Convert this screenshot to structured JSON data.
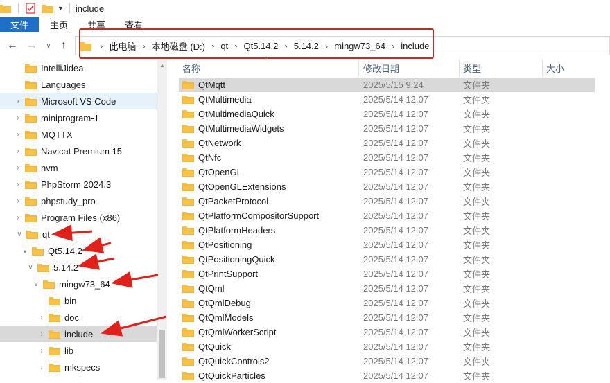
{
  "window": {
    "title": "include"
  },
  "ribbon": {
    "tabs": [
      "文件",
      "主页",
      "共享",
      "查看"
    ]
  },
  "address": {
    "crumbs": [
      "此电脑",
      "本地磁盘 (D:)",
      "qt",
      "Qt5.14.2",
      "5.14.2",
      "mingw73_64",
      "include"
    ]
  },
  "tree": {
    "items": [
      {
        "label": "IntelliJidea",
        "chevron": ""
      },
      {
        "label": "Languages",
        "chevron": ""
      },
      {
        "label": "Microsoft VS Code",
        "chevron": ">"
      },
      {
        "label": "miniprogram-1",
        "chevron": ">"
      },
      {
        "label": "MQTTX",
        "chevron": ">"
      },
      {
        "label": "Navicat Premium 15",
        "chevron": ">"
      },
      {
        "label": "nvm",
        "chevron": ">"
      },
      {
        "label": "PhpStorm 2024.3",
        "chevron": ">"
      },
      {
        "label": "phpstudy_pro",
        "chevron": ">"
      },
      {
        "label": "Program Files (x86)",
        "chevron": ">"
      },
      {
        "label": "qt",
        "chevron": "v"
      },
      {
        "label": "Qt5.14.2",
        "chevron": "v"
      },
      {
        "label": "5.14.2",
        "chevron": "v"
      },
      {
        "label": "mingw73_64",
        "chevron": "v"
      },
      {
        "label": "bin",
        "chevron": ""
      },
      {
        "label": "doc",
        "chevron": ">"
      },
      {
        "label": "include",
        "chevron": ">"
      },
      {
        "label": "lib",
        "chevron": ">"
      },
      {
        "label": "mkspecs",
        "chevron": ">"
      }
    ]
  },
  "files": {
    "columns": {
      "name": "名称",
      "date": "修改日期",
      "type": "类型",
      "size": "大小"
    },
    "rows": [
      {
        "name": "QtMqtt",
        "date": "2025/5/15 9:24",
        "type": "文件夹"
      },
      {
        "name": "QtMultimedia",
        "date": "2025/5/14 12:07",
        "type": "文件夹"
      },
      {
        "name": "QtMultimediaQuick",
        "date": "2025/5/14 12:07",
        "type": "文件夹"
      },
      {
        "name": "QtMultimediaWidgets",
        "date": "2025/5/14 12:07",
        "type": "文件夹"
      },
      {
        "name": "QtNetwork",
        "date": "2025/5/14 12:07",
        "type": "文件夹"
      },
      {
        "name": "QtNfc",
        "date": "2025/5/14 12:07",
        "type": "文件夹"
      },
      {
        "name": "QtOpenGL",
        "date": "2025/5/14 12:07",
        "type": "文件夹"
      },
      {
        "name": "QtOpenGLExtensions",
        "date": "2025/5/14 12:07",
        "type": "文件夹"
      },
      {
        "name": "QtPacketProtocol",
        "date": "2025/5/14 12:07",
        "type": "文件夹"
      },
      {
        "name": "QtPlatformCompositorSupport",
        "date": "2025/5/14 12:07",
        "type": "文件夹"
      },
      {
        "name": "QtPlatformHeaders",
        "date": "2025/5/14 12:07",
        "type": "文件夹"
      },
      {
        "name": "QtPositioning",
        "date": "2025/5/14 12:07",
        "type": "文件夹"
      },
      {
        "name": "QtPositioningQuick",
        "date": "2025/5/14 12:07",
        "type": "文件夹"
      },
      {
        "name": "QtPrintSupport",
        "date": "2025/5/14 12:07",
        "type": "文件夹"
      },
      {
        "name": "QtQml",
        "date": "2025/5/14 12:07",
        "type": "文件夹"
      },
      {
        "name": "QtQmlDebug",
        "date": "2025/5/14 12:07",
        "type": "文件夹"
      },
      {
        "name": "QtQmlModels",
        "date": "2025/5/14 12:07",
        "type": "文件夹"
      },
      {
        "name": "QtQmlWorkerScript",
        "date": "2025/5/14 12:07",
        "type": "文件夹"
      },
      {
        "name": "QtQuick",
        "date": "2025/5/14 12:07",
        "type": "文件夹"
      },
      {
        "name": "QtQuickControls2",
        "date": "2025/5/14 12:07",
        "type": "文件夹"
      },
      {
        "name": "QtQuickParticles",
        "date": "2025/5/14 12:07",
        "type": "文件夹"
      }
    ]
  },
  "colors": {
    "folder": "#f5c146",
    "folder_dark": "#dea422",
    "accent": "#1f6fc6",
    "annotation": "#e0201a"
  }
}
